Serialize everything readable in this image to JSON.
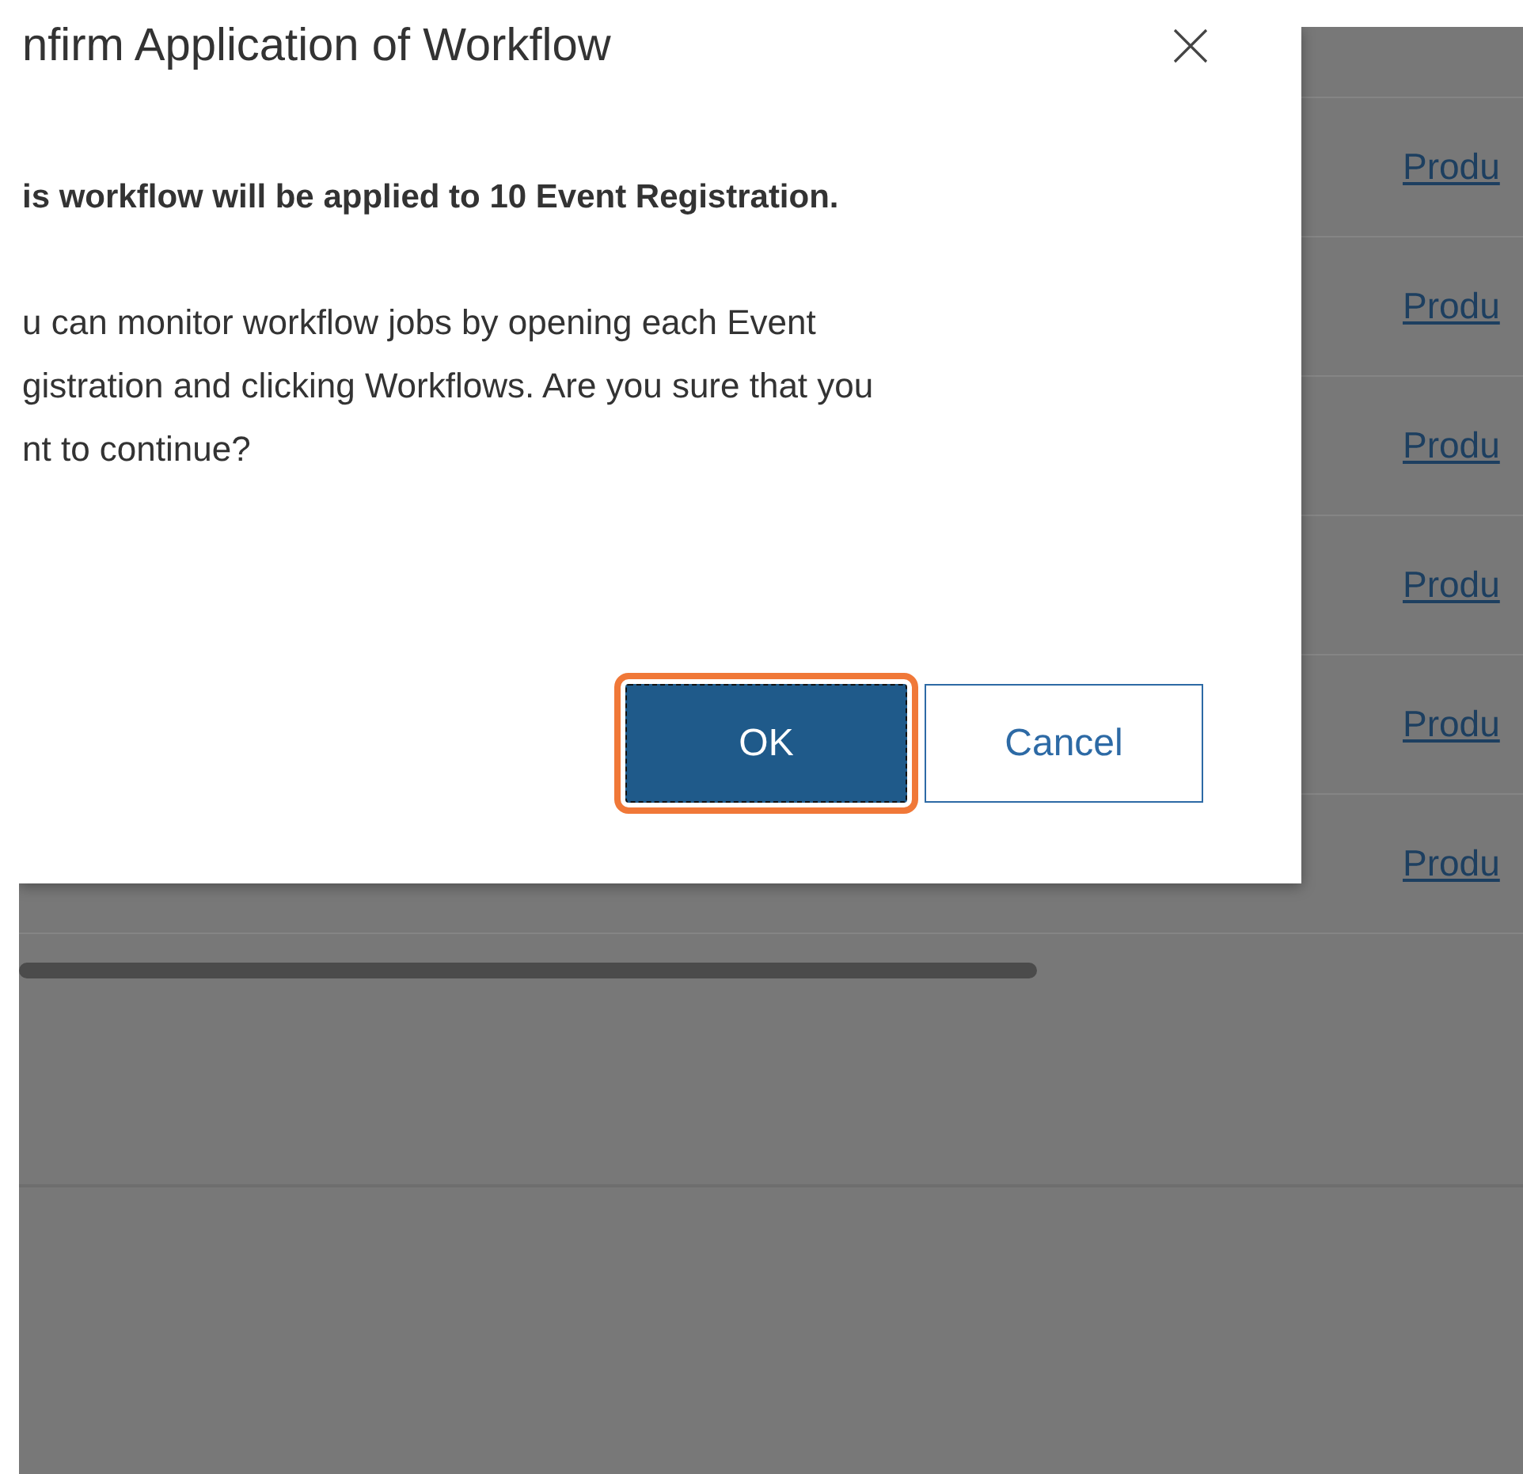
{
  "background_table": {
    "links": [
      "Produ",
      "Produ",
      "Produ",
      "Produ",
      "Produ",
      "Produ"
    ]
  },
  "dialog": {
    "title": "nfirm Application of Workflow",
    "message_bold": "is workflow will be applied to 10 Event Registration.",
    "message_lines": [
      "u can monitor workflow jobs by opening each Event",
      "gistration and clicking Workflows. Are you sure that you",
      "nt to continue?"
    ],
    "buttons": [
      {
        "label": "OK",
        "kind": "primary",
        "focused": true
      },
      {
        "label": "Cancel",
        "kind": "secondary",
        "focused": false
      }
    ]
  }
}
